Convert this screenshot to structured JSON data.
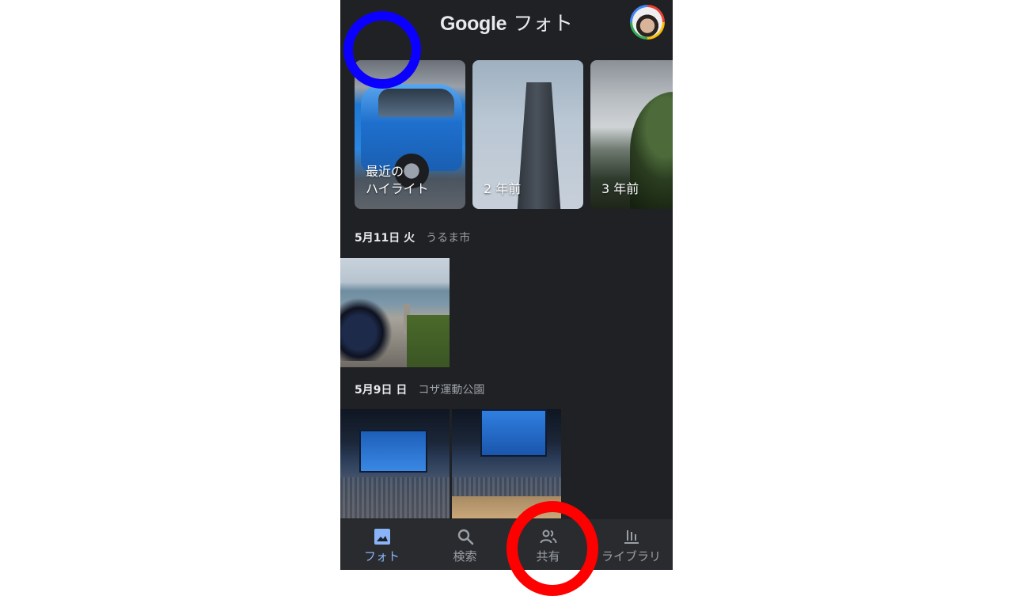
{
  "app": {
    "title_brand": "Google",
    "title_suffix": " フォト",
    "avatar_icon": "user-avatar-icon"
  },
  "memories": [
    {
      "label_line1": "最近の",
      "label_line2": "ハイライト"
    },
    {
      "label_line1": "2 年前",
      "label_line2": ""
    },
    {
      "label_line1": "3 年前",
      "label_line2": ""
    }
  ],
  "groups": [
    {
      "date": "5月11日 火",
      "location": "うるま市"
    },
    {
      "date": "5月9日 日",
      "location": "コザ運動公園"
    }
  ],
  "bottom_nav": [
    {
      "label": "フォト",
      "icon": "photo-icon",
      "active": true
    },
    {
      "label": "検索",
      "icon": "search-icon",
      "active": false
    },
    {
      "label": "共有",
      "icon": "people-icon",
      "active": false
    },
    {
      "label": "ライブラリ",
      "icon": "library-icon",
      "active": false
    }
  ],
  "colors": {
    "background": "#202124",
    "accent": "#8ab4f8",
    "annotation_blue": "#0b00ff",
    "annotation_red": "#ff0000"
  }
}
